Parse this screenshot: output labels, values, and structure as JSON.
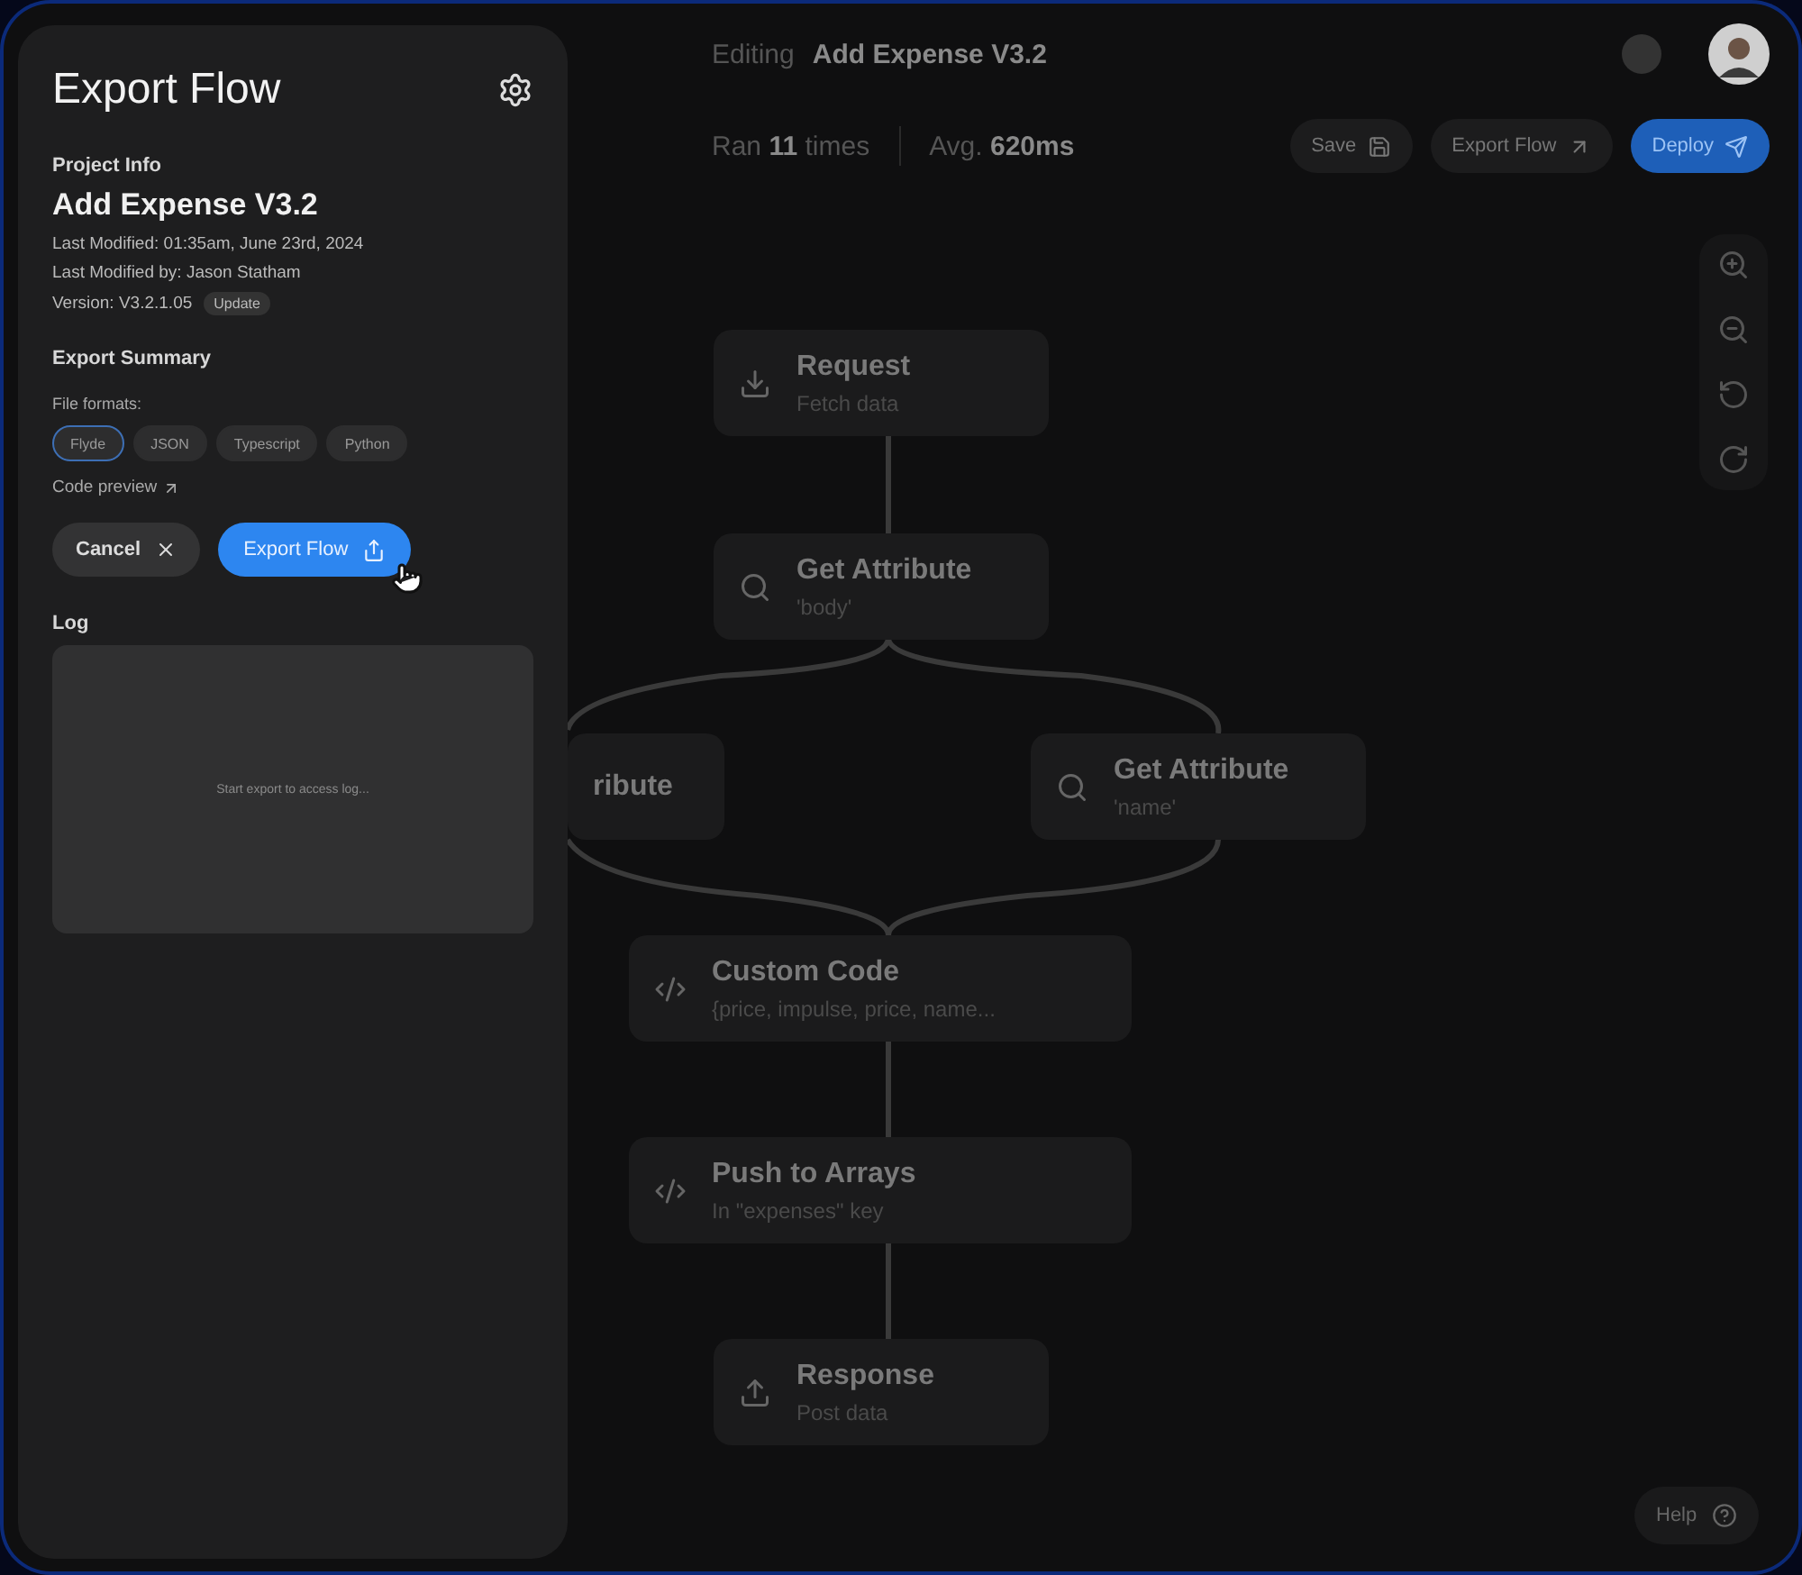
{
  "header": {
    "prefix": "Editing",
    "title": "Add Expense V3.2",
    "stats": [
      {
        "label": "Ran",
        "value": "11",
        "unit": "times"
      },
      {
        "label": "Avg.",
        "value": "620ms"
      }
    ],
    "buttons": [
      {
        "label": "Save",
        "kind": "save",
        "primary": false
      },
      {
        "label": "Export Flow",
        "kind": "export",
        "primary": false
      },
      {
        "label": "Deploy",
        "kind": "deploy",
        "primary": true
      }
    ]
  },
  "nodes": [
    {
      "kind": "download",
      "title": "Request",
      "subtitle": "Fetch data"
    },
    {
      "kind": "search",
      "title": "Get Attribute",
      "subtitle": "'body'"
    },
    {
      "kind": "none",
      "title": "ribute"
    },
    {
      "kind": "search",
      "title": "Get Attribute",
      "subtitle": "'name'"
    },
    {
      "kind": "code",
      "title": "Custom Code",
      "subtitle": "{price, impulse, price, name..."
    },
    {
      "kind": "code",
      "title": "Push to Arrays",
      "subtitle": "In \"expenses\" key"
    },
    {
      "kind": "upload",
      "title": "Response",
      "subtitle": "Post data"
    }
  ],
  "help": "Help",
  "panel": {
    "title": "Export Flow",
    "project_heading": "Project Info",
    "project_name": "Add Expense V3.2",
    "meta": [
      {
        "label": "Last Modified:",
        "value": "01:35am, June 23rd, 2024"
      },
      {
        "label": "Last Modified by:",
        "value": "Jason Statham"
      },
      {
        "label": "Version:",
        "value": "V3.2.1.05"
      }
    ],
    "update_badge": "Update",
    "summary_heading": "Export Summary",
    "formats_label": "File formats:",
    "formats": [
      {
        "label": "Flyde",
        "selected": true
      },
      {
        "label": "JSON",
        "selected": false
      },
      {
        "label": "Typescript",
        "selected": false
      },
      {
        "label": "Python",
        "selected": false
      }
    ],
    "code_preview": "Code preview",
    "cancel": "Cancel",
    "export": "Export Flow",
    "log_heading": "Log",
    "log_placeholder": "Start export to access log..."
  }
}
